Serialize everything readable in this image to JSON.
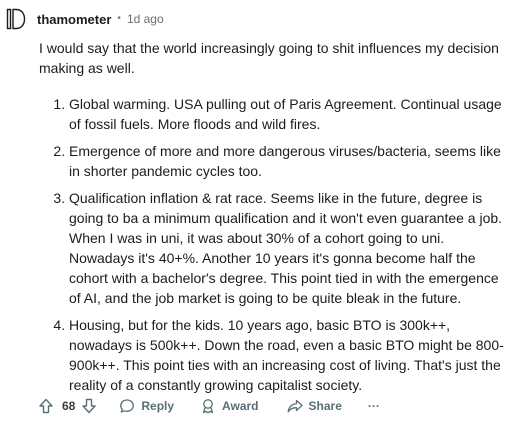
{
  "comment": {
    "username": "thamometer",
    "separator": "•",
    "timestamp": "1d ago",
    "intro": "I would say that the world increasingly going to shit influences my decision making as well.",
    "items": [
      "Global warming. USA pulling out of Paris Agreement. Continual usage of fossil fuels. More floods and wild fires.",
      "Emergence of more and more dangerous viruses/bacteria, seems like in shorter pandemic cycles too.",
      "Qualification inflation & rat race. Seems like in the future, degree is going to ba a minimum qualification and it won't even guarantee a job. When I was in uni, it was about 30% of a cohort going to uni. Nowadays it's 40+%. Another 10 years it's gonna become half the cohort with a bachelor's degree. This point tied in with the emergence of AI, and the job market is going to be quite bleak in the future.",
      "Housing, but for the kids. 10 years ago, basic BTO is 300k++, nowadays is 500k++. Down the road, even a basic BTO might be 800-900k++. This point ties with an increasing cost of living. That's just the reality of a constantly growing capitalist society."
    ]
  },
  "actions": {
    "vote_count": "68",
    "reply_label": "Reply",
    "award_label": "Award",
    "share_label": "Share",
    "more_label": "···"
  },
  "icons": {
    "avatar": "avatar-icon",
    "upvote": "upvote-icon",
    "downvote": "downvote-icon",
    "reply": "reply-icon",
    "award": "award-icon",
    "share": "share-icon"
  },
  "colors": {
    "text": "#1c1c1c",
    "meta": "#6b6f73",
    "action": "#576f76"
  }
}
